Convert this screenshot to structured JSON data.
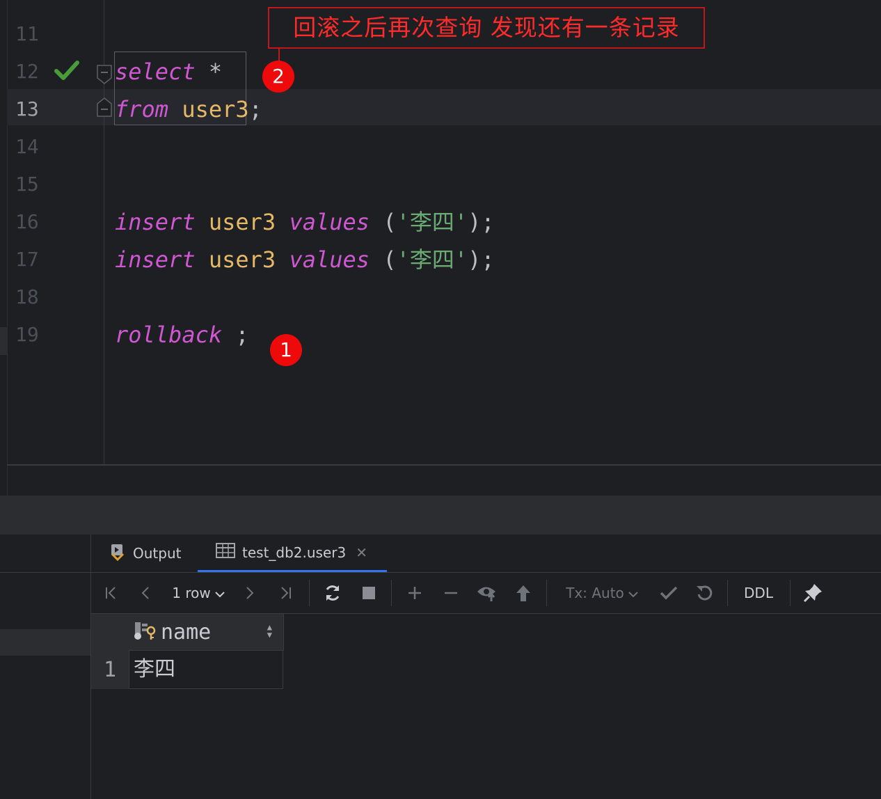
{
  "annotation": {
    "text": "回滚之后再次查询 发现还有一条记录"
  },
  "badges": {
    "first": "1",
    "second": "2"
  },
  "editor": {
    "line_numbers": [
      "11",
      "12",
      "13",
      "14",
      "15",
      "16",
      "17",
      "18",
      "19"
    ],
    "code": {
      "l12_kw": "select",
      "l12_rest": " *",
      "l13_kw": "from",
      "l13_sp": " ",
      "l13_id": "user3",
      "l13_rest": ";",
      "l16_kw1": "insert",
      "l16_sp1": " ",
      "l16_id": "user3",
      "l16_sp2": " ",
      "l16_kw2": "values",
      "l16_p1": " (",
      "l16_str": "'李四'",
      "l16_p2": ");",
      "l17_kw1": "insert",
      "l17_sp1": " ",
      "l17_id": "user3",
      "l17_sp2": " ",
      "l17_kw2": "values",
      "l17_p1": " (",
      "l17_str": "'李四'",
      "l17_p2": ");",
      "l19_kw": "rollback",
      "l19_rest": " ;"
    }
  },
  "tabs": [
    {
      "label": "Output",
      "icon": "output-icon"
    },
    {
      "label": "test_db2.user3",
      "icon": "table-icon"
    }
  ],
  "toolbar": {
    "rows_label": "1 row",
    "tx_label": "Tx: Auto",
    "ddl_label": "DDL"
  },
  "grid": {
    "columns": [
      "name"
    ],
    "rows": [
      {
        "num": "1",
        "name": "李四"
      }
    ]
  },
  "colors": {
    "accent": "#3574f0",
    "keyword": "#cf58d2",
    "identifier": "#e5b967",
    "string": "#6aab73",
    "annotation": "#ff2a2a",
    "check": "#4a9c3a"
  }
}
